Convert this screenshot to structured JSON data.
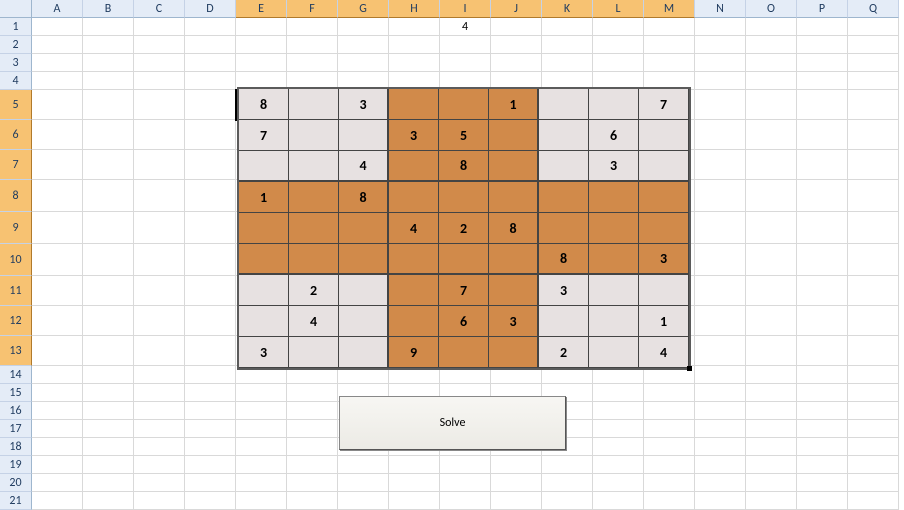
{
  "columns": [
    "A",
    "B",
    "C",
    "D",
    "E",
    "F",
    "G",
    "H",
    "I",
    "J",
    "K",
    "L",
    "M",
    "N",
    "O",
    "P",
    "Q"
  ],
  "selected_columns": [
    "E",
    "F",
    "G",
    "H",
    "I",
    "J",
    "K",
    "L",
    "M"
  ],
  "row_count": 21,
  "selected_rows": [
    5,
    6,
    7,
    8,
    9,
    10,
    11,
    12,
    13
  ],
  "active_cell": {
    "row": 5,
    "col": "E"
  },
  "formula_cell_value": "4",
  "solve_label": "Solve",
  "sudoku": {
    "grid": [
      [
        "8",
        "",
        "3",
        "",
        "",
        "1",
        "",
        "",
        "7"
      ],
      [
        "7",
        "",
        "",
        "3",
        "5",
        "",
        "",
        "6",
        ""
      ],
      [
        "",
        "",
        "4",
        "",
        "8",
        "",
        "",
        "3",
        ""
      ],
      [
        "1",
        "",
        "8",
        "",
        "",
        "",
        "",
        "",
        ""
      ],
      [
        "",
        "",
        "",
        "4",
        "2",
        "8",
        "",
        "",
        ""
      ],
      [
        "",
        "",
        "",
        "",
        "",
        "",
        "8",
        "",
        "3"
      ],
      [
        "",
        "2",
        "",
        "",
        "7",
        "",
        "3",
        "",
        ""
      ],
      [
        "",
        "4",
        "",
        "",
        "6",
        "3",
        "",
        "",
        "1"
      ],
      [
        "3",
        "",
        "",
        "9",
        "",
        "",
        "2",
        "",
        "4"
      ]
    ],
    "chart_data": {
      "type": "table",
      "title": "Sudoku puzzle",
      "rows": 9,
      "cols": 9,
      "values": [
        [
          8,
          null,
          3,
          null,
          null,
          1,
          null,
          null,
          7
        ],
        [
          7,
          null,
          null,
          3,
          5,
          null,
          null,
          6,
          null
        ],
        [
          null,
          null,
          4,
          null,
          8,
          null,
          null,
          3,
          null
        ],
        [
          1,
          null,
          8,
          null,
          null,
          null,
          null,
          null,
          null
        ],
        [
          null,
          null,
          null,
          4,
          2,
          8,
          null,
          null,
          null
        ],
        [
          null,
          null,
          null,
          null,
          null,
          null,
          8,
          null,
          3
        ],
        [
          null,
          2,
          null,
          null,
          7,
          null,
          3,
          null,
          null
        ],
        [
          null,
          4,
          null,
          null,
          6,
          3,
          null,
          null,
          1
        ],
        [
          3,
          null,
          null,
          9,
          null,
          null,
          2,
          null,
          4
        ]
      ]
    },
    "colors": {
      "light": "#e7e1e1",
      "dark": "#d18a4a"
    }
  }
}
